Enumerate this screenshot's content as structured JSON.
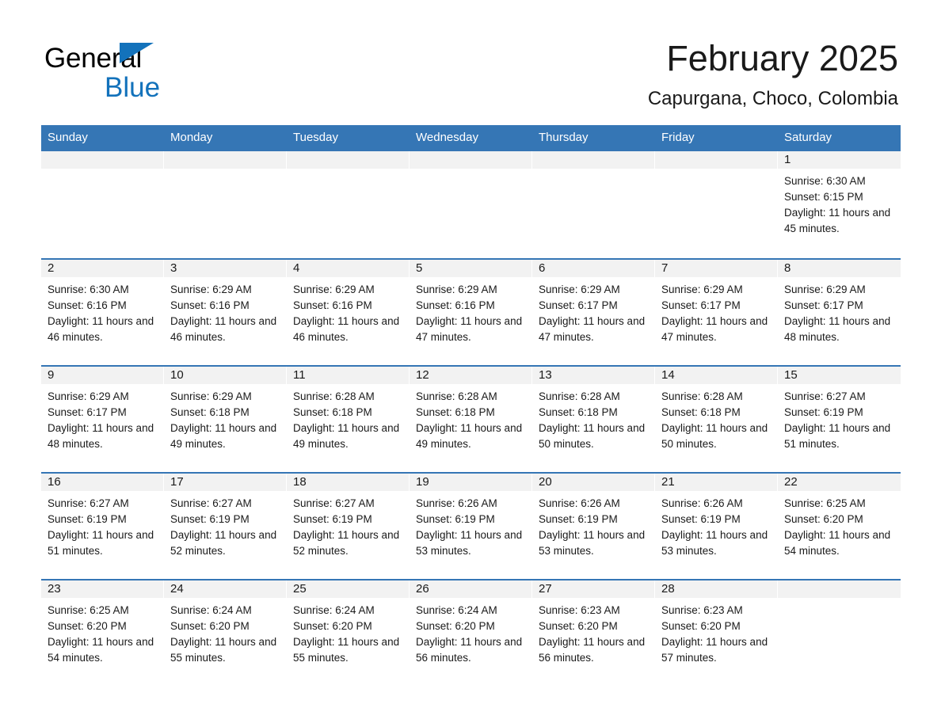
{
  "brand": {
    "name_part1": "General",
    "name_part2": "Blue",
    "triangle_color": "#1372bb"
  },
  "header": {
    "title": "February 2025",
    "subtitle": "Capurgana, Choco, Colombia"
  },
  "theme": {
    "header_blue": "#3576b5",
    "day_band_gray": "#f2f2f2",
    "text_color": "#1a1a1a"
  },
  "weekdays": [
    "Sunday",
    "Monday",
    "Tuesday",
    "Wednesday",
    "Thursday",
    "Friday",
    "Saturday"
  ],
  "weeks": [
    [
      {
        "day": "",
        "empty": true
      },
      {
        "day": "",
        "empty": true
      },
      {
        "day": "",
        "empty": true
      },
      {
        "day": "",
        "empty": true
      },
      {
        "day": "",
        "empty": true
      },
      {
        "day": "",
        "empty": true
      },
      {
        "day": "1",
        "sunrise": "Sunrise: 6:30 AM",
        "sunset": "Sunset: 6:15 PM",
        "daylight": "Daylight: 11 hours and 45 minutes."
      }
    ],
    [
      {
        "day": "2",
        "sunrise": "Sunrise: 6:30 AM",
        "sunset": "Sunset: 6:16 PM",
        "daylight": "Daylight: 11 hours and 46 minutes."
      },
      {
        "day": "3",
        "sunrise": "Sunrise: 6:29 AM",
        "sunset": "Sunset: 6:16 PM",
        "daylight": "Daylight: 11 hours and 46 minutes."
      },
      {
        "day": "4",
        "sunrise": "Sunrise: 6:29 AM",
        "sunset": "Sunset: 6:16 PM",
        "daylight": "Daylight: 11 hours and 46 minutes."
      },
      {
        "day": "5",
        "sunrise": "Sunrise: 6:29 AM",
        "sunset": "Sunset: 6:16 PM",
        "daylight": "Daylight: 11 hours and 47 minutes."
      },
      {
        "day": "6",
        "sunrise": "Sunrise: 6:29 AM",
        "sunset": "Sunset: 6:17 PM",
        "daylight": "Daylight: 11 hours and 47 minutes."
      },
      {
        "day": "7",
        "sunrise": "Sunrise: 6:29 AM",
        "sunset": "Sunset: 6:17 PM",
        "daylight": "Daylight: 11 hours and 47 minutes."
      },
      {
        "day": "8",
        "sunrise": "Sunrise: 6:29 AM",
        "sunset": "Sunset: 6:17 PM",
        "daylight": "Daylight: 11 hours and 48 minutes."
      }
    ],
    [
      {
        "day": "9",
        "sunrise": "Sunrise: 6:29 AM",
        "sunset": "Sunset: 6:17 PM",
        "daylight": "Daylight: 11 hours and 48 minutes."
      },
      {
        "day": "10",
        "sunrise": "Sunrise: 6:29 AM",
        "sunset": "Sunset: 6:18 PM",
        "daylight": "Daylight: 11 hours and 49 minutes."
      },
      {
        "day": "11",
        "sunrise": "Sunrise: 6:28 AM",
        "sunset": "Sunset: 6:18 PM",
        "daylight": "Daylight: 11 hours and 49 minutes."
      },
      {
        "day": "12",
        "sunrise": "Sunrise: 6:28 AM",
        "sunset": "Sunset: 6:18 PM",
        "daylight": "Daylight: 11 hours and 49 minutes."
      },
      {
        "day": "13",
        "sunrise": "Sunrise: 6:28 AM",
        "sunset": "Sunset: 6:18 PM",
        "daylight": "Daylight: 11 hours and 50 minutes."
      },
      {
        "day": "14",
        "sunrise": "Sunrise: 6:28 AM",
        "sunset": "Sunset: 6:18 PM",
        "daylight": "Daylight: 11 hours and 50 minutes."
      },
      {
        "day": "15",
        "sunrise": "Sunrise: 6:27 AM",
        "sunset": "Sunset: 6:19 PM",
        "daylight": "Daylight: 11 hours and 51 minutes."
      }
    ],
    [
      {
        "day": "16",
        "sunrise": "Sunrise: 6:27 AM",
        "sunset": "Sunset: 6:19 PM",
        "daylight": "Daylight: 11 hours and 51 minutes."
      },
      {
        "day": "17",
        "sunrise": "Sunrise: 6:27 AM",
        "sunset": "Sunset: 6:19 PM",
        "daylight": "Daylight: 11 hours and 52 minutes."
      },
      {
        "day": "18",
        "sunrise": "Sunrise: 6:27 AM",
        "sunset": "Sunset: 6:19 PM",
        "daylight": "Daylight: 11 hours and 52 minutes."
      },
      {
        "day": "19",
        "sunrise": "Sunrise: 6:26 AM",
        "sunset": "Sunset: 6:19 PM",
        "daylight": "Daylight: 11 hours and 53 minutes."
      },
      {
        "day": "20",
        "sunrise": "Sunrise: 6:26 AM",
        "sunset": "Sunset: 6:19 PM",
        "daylight": "Daylight: 11 hours and 53 minutes."
      },
      {
        "day": "21",
        "sunrise": "Sunrise: 6:26 AM",
        "sunset": "Sunset: 6:19 PM",
        "daylight": "Daylight: 11 hours and 53 minutes."
      },
      {
        "day": "22",
        "sunrise": "Sunrise: 6:25 AM",
        "sunset": "Sunset: 6:20 PM",
        "daylight": "Daylight: 11 hours and 54 minutes."
      }
    ],
    [
      {
        "day": "23",
        "sunrise": "Sunrise: 6:25 AM",
        "sunset": "Sunset: 6:20 PM",
        "daylight": "Daylight: 11 hours and 54 minutes."
      },
      {
        "day": "24",
        "sunrise": "Sunrise: 6:24 AM",
        "sunset": "Sunset: 6:20 PM",
        "daylight": "Daylight: 11 hours and 55 minutes."
      },
      {
        "day": "25",
        "sunrise": "Sunrise: 6:24 AM",
        "sunset": "Sunset: 6:20 PM",
        "daylight": "Daylight: 11 hours and 55 minutes."
      },
      {
        "day": "26",
        "sunrise": "Sunrise: 6:24 AM",
        "sunset": "Sunset: 6:20 PM",
        "daylight": "Daylight: 11 hours and 56 minutes."
      },
      {
        "day": "27",
        "sunrise": "Sunrise: 6:23 AM",
        "sunset": "Sunset: 6:20 PM",
        "daylight": "Daylight: 11 hours and 56 minutes."
      },
      {
        "day": "28",
        "sunrise": "Sunrise: 6:23 AM",
        "sunset": "Sunset: 6:20 PM",
        "daylight": "Daylight: 11 hours and 57 minutes."
      },
      {
        "day": "",
        "empty": true
      }
    ]
  ]
}
